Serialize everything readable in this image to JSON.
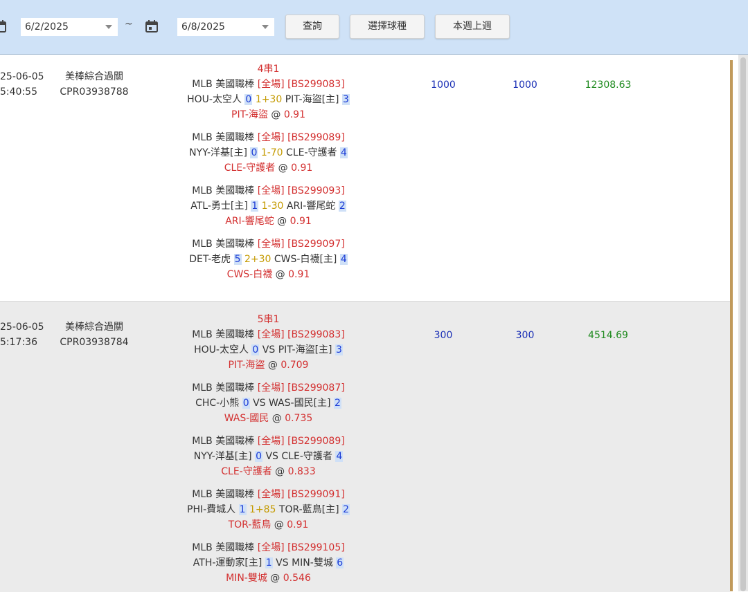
{
  "toolbar": {
    "start_date": "6/2/2025",
    "end_date": "6/8/2025",
    "tilde": "~",
    "query_label": "查詢",
    "select_sport_label": "選擇球種",
    "week_label": "本週上週"
  },
  "colors": {
    "toolbar_bg": "#cfe2f7",
    "red": "#d32f2f",
    "gold": "#c49a00",
    "blue_amount": "#1a2fb5",
    "green_win": "#1e8a1e",
    "accent_bar": "#c19a5b"
  },
  "rows": [
    {
      "date": "25-06-05",
      "time": "5:40:55",
      "kind": "美棒綜合過關",
      "order_id": "CPR03938788",
      "parlay": "4串1",
      "stake": "1000",
      "valid": "1000",
      "win": "12308.63",
      "bets": [
        {
          "league": "MLB 美國職棒",
          "scope": "[全場]",
          "code": "[BS299083]",
          "home_or_a": "HOU-太空人",
          "score_a": "0",
          "line": "1+30",
          "team_b": "PIT-海盜[主]",
          "score_b": "3",
          "pick": "PIT-海盜",
          "odds": "0.91"
        },
        {
          "league": "MLB 美國職棒",
          "scope": "[全場]",
          "code": "[BS299089]",
          "home_or_a": "NYY-洋基[主]",
          "score_a": "0",
          "line": "1-70",
          "team_b": "CLE-守護者",
          "score_b": "4",
          "pick": "CLE-守護者",
          "odds": "0.91"
        },
        {
          "league": "MLB 美國職棒",
          "scope": "[全場]",
          "code": "[BS299093]",
          "home_or_a": "ATL-勇士[主]",
          "score_a": "1",
          "line": "1-30",
          "team_b": "ARI-響尾蛇",
          "score_b": "2",
          "pick": "ARI-響尾蛇",
          "odds": "0.91"
        },
        {
          "league": "MLB 美國職棒",
          "scope": "[全場]",
          "code": "[BS299097]",
          "home_or_a": "DET-老虎",
          "score_a": "5",
          "line": "2+30",
          "team_b": "CWS-白襪[主]",
          "score_b": "4",
          "pick": "CWS-白襪",
          "odds": "0.91"
        }
      ]
    },
    {
      "date": "25-06-05",
      "time": "5:17:36",
      "kind": "美棒綜合過關",
      "order_id": "CPR03938784",
      "parlay": "5串1",
      "stake": "300",
      "valid": "300",
      "win": "4514.69",
      "bets": [
        {
          "league": "MLB 美國職棒",
          "scope": "[全場]",
          "code": "[BS299083]",
          "home_or_a": "HOU-太空人",
          "score_a": "0",
          "line": "VS",
          "team_b": "PIT-海盜[主]",
          "score_b": "3",
          "pick": "PIT-海盜",
          "odds": "0.709"
        },
        {
          "league": "MLB 美國職棒",
          "scope": "[全場]",
          "code": "[BS299087]",
          "home_or_a": "CHC-小熊",
          "score_a": "0",
          "line": "VS",
          "team_b": "WAS-國民[主]",
          "score_b": "2",
          "pick": "WAS-國民",
          "odds": "0.735"
        },
        {
          "league": "MLB 美國職棒",
          "scope": "[全場]",
          "code": "[BS299089]",
          "home_or_a": "NYY-洋基[主]",
          "score_a": "0",
          "line": "VS",
          "team_b": "CLE-守護者",
          "score_b": "4",
          "pick": "CLE-守護者",
          "odds": "0.833"
        },
        {
          "league": "MLB 美國職棒",
          "scope": "[全場]",
          "code": "[BS299091]",
          "home_or_a": "PHI-費城人",
          "score_a": "1",
          "line": "1+85",
          "team_b": "TOR-藍鳥[主]",
          "score_b": "2",
          "pick": "TOR-藍鳥",
          "odds": "0.91"
        },
        {
          "league": "MLB 美國職棒",
          "scope": "[全場]",
          "code": "[BS299105]",
          "home_or_a": "ATH-運動家[主]",
          "score_a": "1",
          "line": "VS",
          "team_b": "MIN-雙城",
          "score_b": "6",
          "pick": "MIN-雙城",
          "odds": "0.546"
        }
      ]
    }
  ]
}
